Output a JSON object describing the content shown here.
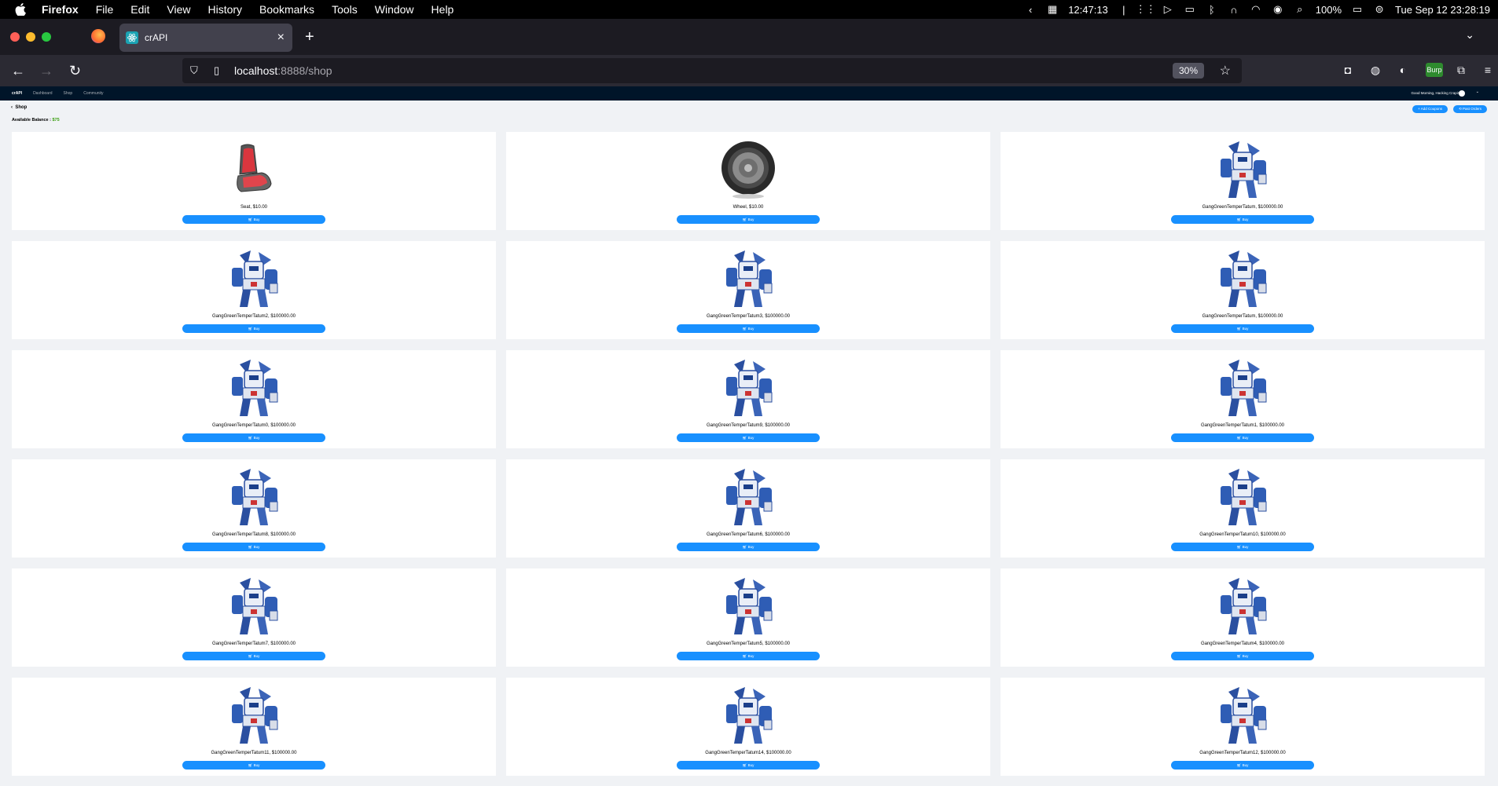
{
  "menubar": {
    "app_name": "Firefox",
    "items": [
      "File",
      "Edit",
      "View",
      "History",
      "Bookmarks",
      "Tools",
      "Window",
      "Help"
    ],
    "clock_small": "12:47:13",
    "battery": "100%",
    "datetime": "Tue Sep 12  23:28:19"
  },
  "browser": {
    "tab_title": "crAPI",
    "url_host": "localhost",
    "url_path": ":8888/shop",
    "zoom": "30%",
    "extension_badge": "Burp"
  },
  "app": {
    "brand": "crAPI",
    "nav": [
      "Dashboard",
      "Shop",
      "Community"
    ],
    "welcome": "Good Morning, Hacking Crapi!",
    "back_label": "Shop",
    "balance_label": "Available Balance :",
    "balance_value": "$75",
    "add_coupons": "Add Coupons",
    "past_orders": "Past Orders",
    "buy_label": "Buy"
  },
  "products": [
    {
      "name": "Seat, $10.00",
      "image": "car-seat-icon"
    },
    {
      "name": "Wheel, $10.00",
      "image": "wheel-icon"
    },
    {
      "name": "GangGreenTemperTatum, $100000.00",
      "image": "robot-image"
    },
    {
      "name": "GangGreenTemperTatum2, $100000.00",
      "image": "robot-image"
    },
    {
      "name": "GangGreenTemperTatum3, $100000.00",
      "image": "robot-image"
    },
    {
      "name": "GangGreenTemperTatum, $100000.00",
      "image": "robot-image"
    },
    {
      "name": "GangGreenTemperTatum0, $100000.00",
      "image": "robot-image"
    },
    {
      "name": "GangGreenTemperTatum9, $100000.00",
      "image": "robot-image"
    },
    {
      "name": "GangGreenTemperTatum1, $100000.00",
      "image": "robot-image"
    },
    {
      "name": "GangGreenTemperTatum8, $100000.00",
      "image": "robot-image"
    },
    {
      "name": "GangGreenTemperTatum6, $100000.00",
      "image": "robot-image"
    },
    {
      "name": "GangGreenTemperTatum10, $100000.00",
      "image": "robot-image"
    },
    {
      "name": "GangGreenTemperTatum7, $100000.00",
      "image": "robot-image"
    },
    {
      "name": "GangGreenTemperTatum5, $100000.00",
      "image": "robot-image"
    },
    {
      "name": "GangGreenTemperTatum4, $100000.00",
      "image": "robot-image"
    },
    {
      "name": "GangGreenTemperTatum11, $100000.00",
      "image": "robot-image"
    },
    {
      "name": "GangGreenTemperTatum14, $100000.00",
      "image": "robot-image"
    },
    {
      "name": "GangGreenTemperTatum12, $100000.00",
      "image": "robot-image"
    }
  ],
  "colors": {
    "primary": "#1890ff",
    "header_bg": "#001529",
    "content_bg": "#f0f2f5",
    "balance": "#389e0d"
  }
}
